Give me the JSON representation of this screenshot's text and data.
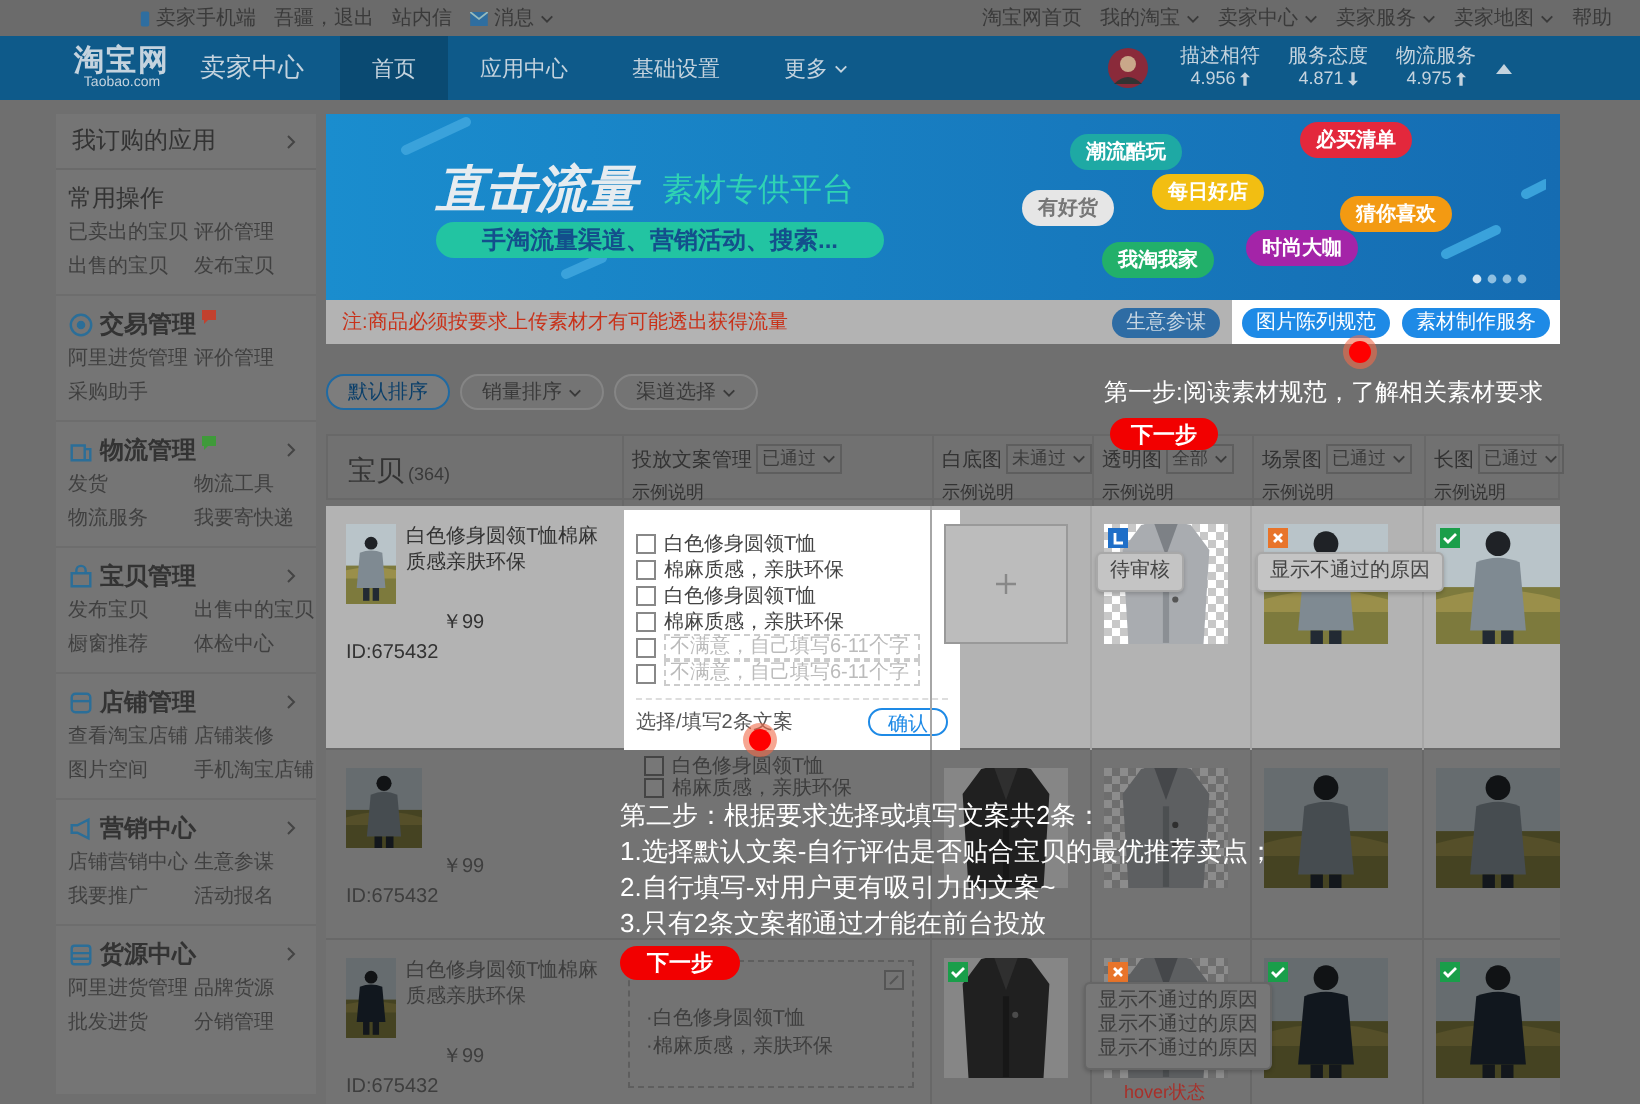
{
  "top_bar": {
    "left": [
      {
        "kind": "phone",
        "label": "卖家手机端",
        "dropdown": false
      },
      {
        "kind": "text",
        "label": "吾疆，退出",
        "dropdown": false
      },
      {
        "kind": "text",
        "label": "站内信",
        "dropdown": false
      },
      {
        "kind": "mail",
        "label": "消息",
        "dropdown": true
      }
    ],
    "right": [
      {
        "label": "淘宝网首页",
        "dropdown": false
      },
      {
        "label": "我的淘宝",
        "dropdown": true
      },
      {
        "label": "卖家中心",
        "dropdown": true
      },
      {
        "label": "卖家服务",
        "dropdown": true
      },
      {
        "label": "卖家地图",
        "dropdown": true
      },
      {
        "label": "帮助",
        "dropdown": false
      }
    ]
  },
  "header": {
    "logo": "淘宝网",
    "logo_sub": "Taobao.com",
    "title": "卖家中心",
    "nav": [
      {
        "label": "首页",
        "selected": true,
        "dropdown": false
      },
      {
        "label": "应用中心",
        "selected": false,
        "dropdown": false
      },
      {
        "label": "基础设置",
        "selected": false,
        "dropdown": false
      },
      {
        "label": "更多",
        "selected": false,
        "dropdown": true
      }
    ],
    "ratings": [
      {
        "label": "描述相符",
        "value": "4.956",
        "rising": true
      },
      {
        "label": "服务态度",
        "value": "4.871",
        "rising": false
      },
      {
        "label": "物流服务",
        "value": "4.975",
        "rising": true
      }
    ]
  },
  "sidebar": {
    "title": "我订购的应用",
    "sections": [
      {
        "kind": "plain",
        "title": "常用操作",
        "arrow": false,
        "items": [
          "已卖出的宝贝",
          "评价管理",
          "出售的宝贝",
          "发布宝贝"
        ]
      },
      {
        "kind": "trade",
        "title": "交易管理",
        "arrow": false,
        "color": "#c2412e",
        "items": [
          "阿里进货管理",
          "评价管理",
          "采购助手"
        ]
      },
      {
        "kind": "logistics",
        "title": "物流管理",
        "arrow": true,
        "color": "#3f9a3a",
        "items": [
          "发货",
          "物流工具",
          "物流服务",
          "我要寄快递"
        ]
      },
      {
        "kind": "goods",
        "title": "宝贝管理",
        "arrow": true,
        "items": [
          "发布宝贝",
          "出售中的宝贝",
          "橱窗推荐",
          "体检中心"
        ]
      },
      {
        "kind": "shop",
        "title": "店铺管理",
        "arrow": true,
        "items": [
          "查看淘宝店铺",
          "店铺装修",
          "图片空间",
          "手机淘宝店铺"
        ]
      },
      {
        "kind": "marketing",
        "title": "营销中心",
        "arrow": true,
        "items": [
          "店铺营销中心",
          "生意参谋",
          "我要推广",
          "活动报名"
        ]
      },
      {
        "kind": "supply",
        "title": "货源中心",
        "arrow": true,
        "items": [
          "阿里进货管理",
          "品牌货源",
          "批发进货",
          "分销管理"
        ]
      }
    ]
  },
  "banner": {
    "headline": "直击流量",
    "subhead": "素材专供平台",
    "pill": "手淘流量渠道、营销活动、搜索...",
    "tags": [
      {
        "label": "潮流酷玩",
        "color": "#1ea9a4"
      },
      {
        "label": "必买清单",
        "color": "#e3283c"
      },
      {
        "label": "有好货",
        "color": "#e6e6e6"
      },
      {
        "label": "每日好店",
        "color": "#f2be12"
      },
      {
        "label": "猜你喜欢",
        "color": "#f39a12"
      },
      {
        "label": "我淘我家",
        "color": "#22b06a"
      },
      {
        "label": "时尚大咖",
        "color": "#a424a8"
      }
    ],
    "note": "注:商品必须按要求上传素材才有可能透出获得流量",
    "buttons": [
      {
        "label": "生意参谋",
        "highlighted": false
      },
      {
        "label": "图片陈列规范",
        "highlighted": true
      },
      {
        "label": "素材制作服务",
        "highlighted": true
      }
    ]
  },
  "sort_buttons": [
    {
      "label": "默认排序",
      "selected": true,
      "dropdown": false
    },
    {
      "label": "销量排序",
      "selected": false,
      "dropdown": true
    },
    {
      "label": "渠道选择",
      "selected": false,
      "dropdown": true
    }
  ],
  "table": {
    "product_column": "宝贝",
    "count": "(364)",
    "columns": [
      {
        "label": "投放文案管理",
        "filter": "已通过",
        "hint": "示例说明"
      },
      {
        "label": "白底图",
        "filter": "未通过",
        "hint": "示例说明"
      },
      {
        "label": "透明图",
        "filter": "全部",
        "hint": "示例说明"
      },
      {
        "label": "场景图",
        "filter": "已通过",
        "hint": "示例说明"
      },
      {
        "label": "长图",
        "filter": "已通过",
        "hint": "示例说明"
      }
    ],
    "rows": [
      {
        "highlighted": true,
        "product": {
          "title": "白色修身圆领T恤棉麻质感亲肤环保",
          "price": "￥99",
          "id": "ID:675432"
        },
        "copy": {
          "kind": "editor",
          "options": [
            {
              "text": "白色修身圆领T恤",
              "checked": false
            },
            {
              "text": "棉麻质感，亲肤环保",
              "checked": false
            },
            {
              "text": "白色修身圆领T恤",
              "checked": false
            },
            {
              "text": "棉麻质感，亲肤环保",
              "checked": false
            }
          ],
          "inputs": [
            {
              "placeholder": "不满意，自己填写6-11个字",
              "checked": false
            },
            {
              "placeholder": "不满意，自己填写6-11个字",
              "checked": false
            }
          ],
          "footer": "选择/填写2条文案",
          "button": "确认"
        },
        "images": [
          {
            "kind": "upload"
          },
          {
            "kind": "pending",
            "tooltip": [
              "待审核"
            ]
          },
          {
            "kind": "rejected",
            "tooltip": [
              "显示不通过的原因"
            ]
          },
          {
            "kind": "approved"
          }
        ]
      },
      {
        "highlighted": false,
        "product": {
          "price": "￥99",
          "id": "ID:675432"
        },
        "copy": {
          "kind": "list",
          "options": [
            {
              "text": "白色修身圆领T恤",
              "checked": false
            },
            {
              "text": "棉麻质感，亲肤环保",
              "checked": false
            }
          ]
        },
        "images": [
          {
            "kind": "plain"
          },
          {
            "kind": "plain"
          },
          {
            "kind": "plain"
          },
          {
            "kind": "plain"
          }
        ]
      },
      {
        "highlighted": false,
        "product": {
          "title": "白色修身圆领T恤棉麻质感亲肤环保",
          "price": "￥99",
          "id": "ID:675432"
        },
        "copy": {
          "kind": "summary",
          "bullets": [
            "·白色修身圆领T恤",
            "·棉麻质感，亲肤环保"
          ]
        },
        "images": [
          {
            "kind": "approved"
          },
          {
            "kind": "rejected",
            "tooltip": [
              "显示不通过的原因",
              "显示不通过的原因",
              "显示不通过的原因"
            ],
            "caption": "hover状态"
          },
          {
            "kind": "approved"
          },
          {
            "kind": "approved"
          }
        ]
      }
    ]
  },
  "guide": {
    "step1": {
      "text": "第一步:阅读素材规范，了解相关素材要求",
      "button": "下一步"
    },
    "step2": {
      "lines": [
        "第二步：根据要求选择或填写文案共2条：",
        "1.选择默认文案-自行评估是否贴合宝贝的最优推荐卖点；",
        "2.自行填写-对用户更有吸引力的文案~",
        "3.只有2条文案都通过才能在前台投放"
      ],
      "button": "下一步"
    }
  }
}
